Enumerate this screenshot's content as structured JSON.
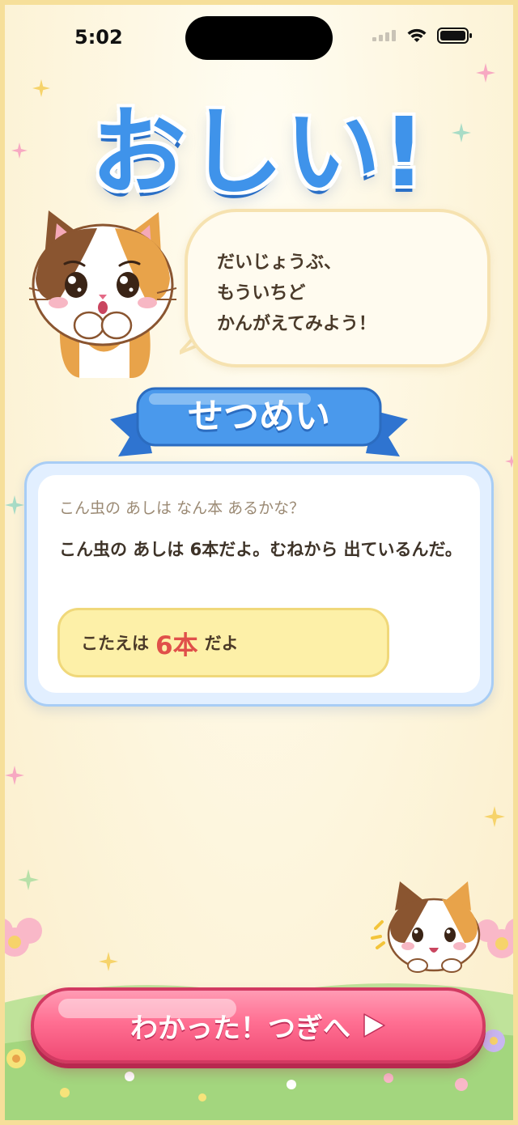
{
  "status_bar": {
    "time": "5:02"
  },
  "title": "おしい!",
  "speech": {
    "lines": [
      "だいじょうぶ、",
      "もういちど",
      "かんがえてみよう！"
    ]
  },
  "section_label": "せつめい",
  "card": {
    "question": "こん虫の あしは なん本 あるかな？",
    "explanation": "こん虫の あしは 6本だよ。むねから 出ているんだ。",
    "answer_prefix": "こたえは",
    "answer_value": "6本",
    "answer_suffix": "だよ"
  },
  "next_button": {
    "label": "わかった！つぎへ"
  },
  "colors": {
    "title_blue": "#3f93ea",
    "ribbon_blue": "#3a86e0",
    "button_pink": "#ff6f92",
    "answer_red": "#e0504a",
    "answer_box": "#fdf0a8"
  },
  "icons": [
    "signal-icon",
    "wifi-icon",
    "battery-icon",
    "play-arrow-icon",
    "cat-mascot",
    "sparkle-icon",
    "flower-icon"
  ]
}
